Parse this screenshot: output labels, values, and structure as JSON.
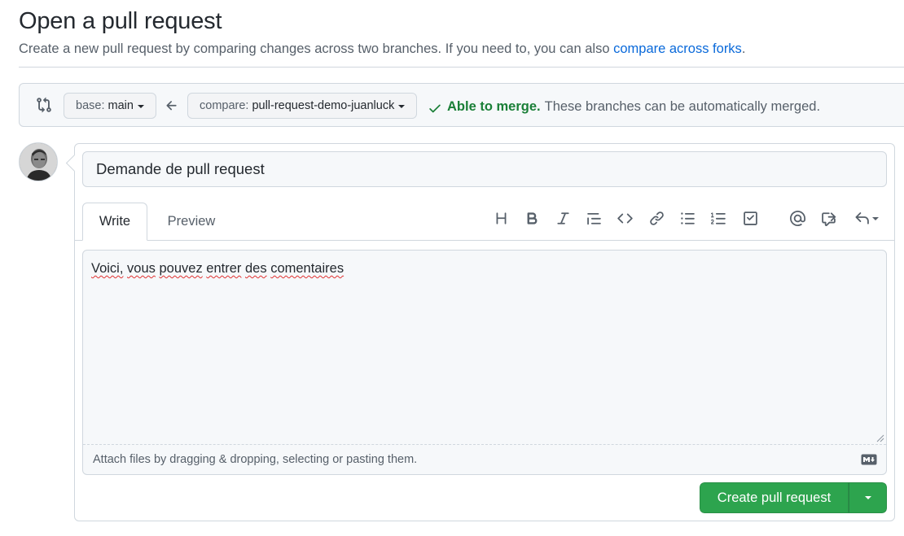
{
  "header": {
    "title": "Open a pull request",
    "subtitle_text": "Create a new pull request by comparing changes across two branches. If you need to, you can also ",
    "subtitle_link": "compare across forks",
    "subtitle_end": "."
  },
  "compare_bar": {
    "base_label": "base:",
    "base_value": "main",
    "compare_label": "compare:",
    "compare_value": "pull-request-demo-juanluck",
    "merge_ok": "Able to merge.",
    "merge_message": "These branches can be automatically merged."
  },
  "form": {
    "title_value": "Demande de pull request",
    "tabs": [
      {
        "label": "Write"
      },
      {
        "label": "Preview"
      }
    ],
    "toolbar_icons": [
      "heading-icon",
      "bold-icon",
      "italic-icon",
      "quote-icon",
      "code-icon",
      "link-icon",
      "unordered-list-icon",
      "ordered-list-icon",
      "task-list-icon",
      "mention-icon",
      "cross-reference-icon",
      "reply-icon"
    ],
    "body_words": [
      "Voici,",
      " ",
      "vous",
      " ",
      "pouvez",
      " ",
      "entrer",
      " ",
      "des",
      " ",
      "comentaires"
    ],
    "attach_text": "Attach files by dragging & dropping, selecting or pasting them.",
    "create_button": "Create pull request"
  },
  "colors": {
    "accent_link": "#0969da",
    "success": "#1a7f37",
    "primary_button": "#2da44e"
  }
}
